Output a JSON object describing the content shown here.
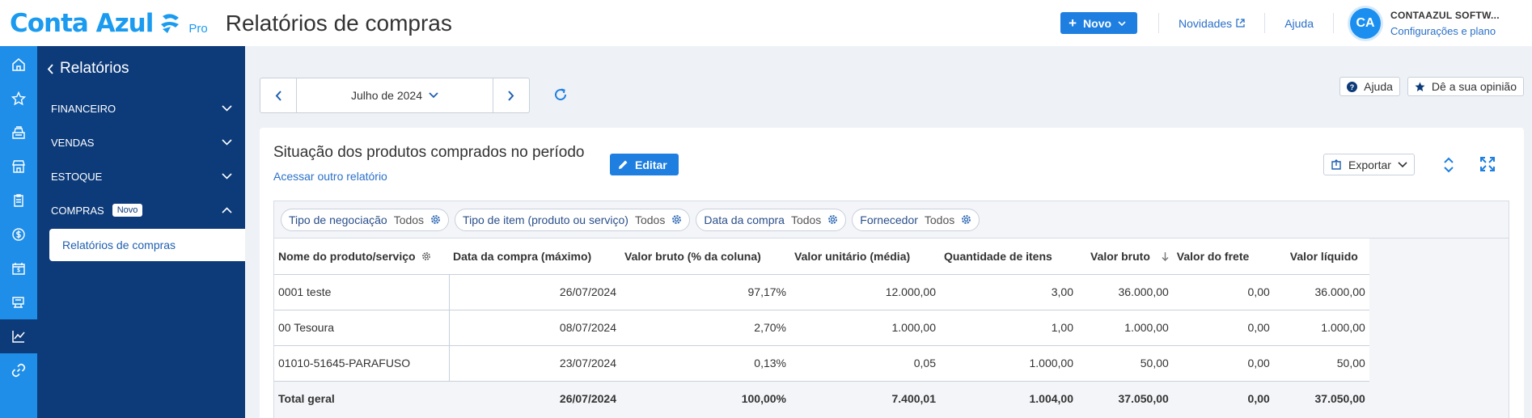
{
  "brand": {
    "name": "Conta Azul",
    "tier": "Pro",
    "color": "#1a9bf0"
  },
  "header": {
    "title": "Relatórios de compras",
    "new_button": "Novo",
    "news_link": "Novidades",
    "help_link": "Ajuda",
    "account": {
      "initials": "CA",
      "name": "CONTAAZUL SOFTW...",
      "sub": "Configurações e plano"
    }
  },
  "rail": {
    "icons": [
      "home-icon",
      "star-icon",
      "cash-register-icon",
      "store-icon",
      "clipboard-icon",
      "dollar-icon",
      "calendar-dollar-icon",
      "cart-icon",
      "chart-icon",
      "link-icon"
    ],
    "active": "chart-icon"
  },
  "sidebar": {
    "back_label": "Relatórios",
    "sections": [
      {
        "label": "FINANCEIRO",
        "expanded": false
      },
      {
        "label": "VENDAS",
        "expanded": false
      },
      {
        "label": "ESTOQUE",
        "expanded": false
      },
      {
        "label": "COMPRAS",
        "badge": "Novo",
        "expanded": true
      }
    ],
    "sub_item": "Relatórios de compras"
  },
  "period": {
    "label": "Julho de 2024"
  },
  "help_buttons": {
    "help": "Ajuda",
    "feedback": "Dê a sua opinião"
  },
  "report": {
    "title": "Situação dos produtos comprados no período",
    "other_link": "Acessar outro relatório",
    "edit_button": "Editar",
    "export_button": "Exportar",
    "filters": [
      {
        "label": "Tipo de negociação",
        "value": "Todos"
      },
      {
        "label": "Tipo de item (produto ou serviço)",
        "value": "Todos"
      },
      {
        "label": "Data da compra",
        "value": "Todos"
      },
      {
        "label": "Fornecedor",
        "value": "Todos"
      }
    ],
    "columns": [
      "Nome do produto/serviço",
      "Data da compra (máximo)",
      "Valor bruto (% da coluna)",
      "Valor unitário (média)",
      "Quantidade de itens",
      "Valor bruto",
      "Valor do frete",
      "Valor líquido"
    ],
    "rows": [
      [
        "0001 teste",
        "26/07/2024",
        "97,17%",
        "12.000,00",
        "3,00",
        "36.000,00",
        "0,00",
        "36.000,00"
      ],
      [
        "00 Tesoura",
        "08/07/2024",
        "2,70%",
        "1.000,00",
        "1,00",
        "1.000,00",
        "0,00",
        "1.000,00"
      ],
      [
        "01010-51645-PARAFUSO",
        "23/07/2024",
        "0,13%",
        "0,05",
        "1.000,00",
        "50,00",
        "0,00",
        "50,00"
      ]
    ],
    "total": [
      "Total geral",
      "26/07/2024",
      "100,00%",
      "7.400,01",
      "1.004,00",
      "37.050,00",
      "0,00",
      "37.050,00"
    ]
  }
}
